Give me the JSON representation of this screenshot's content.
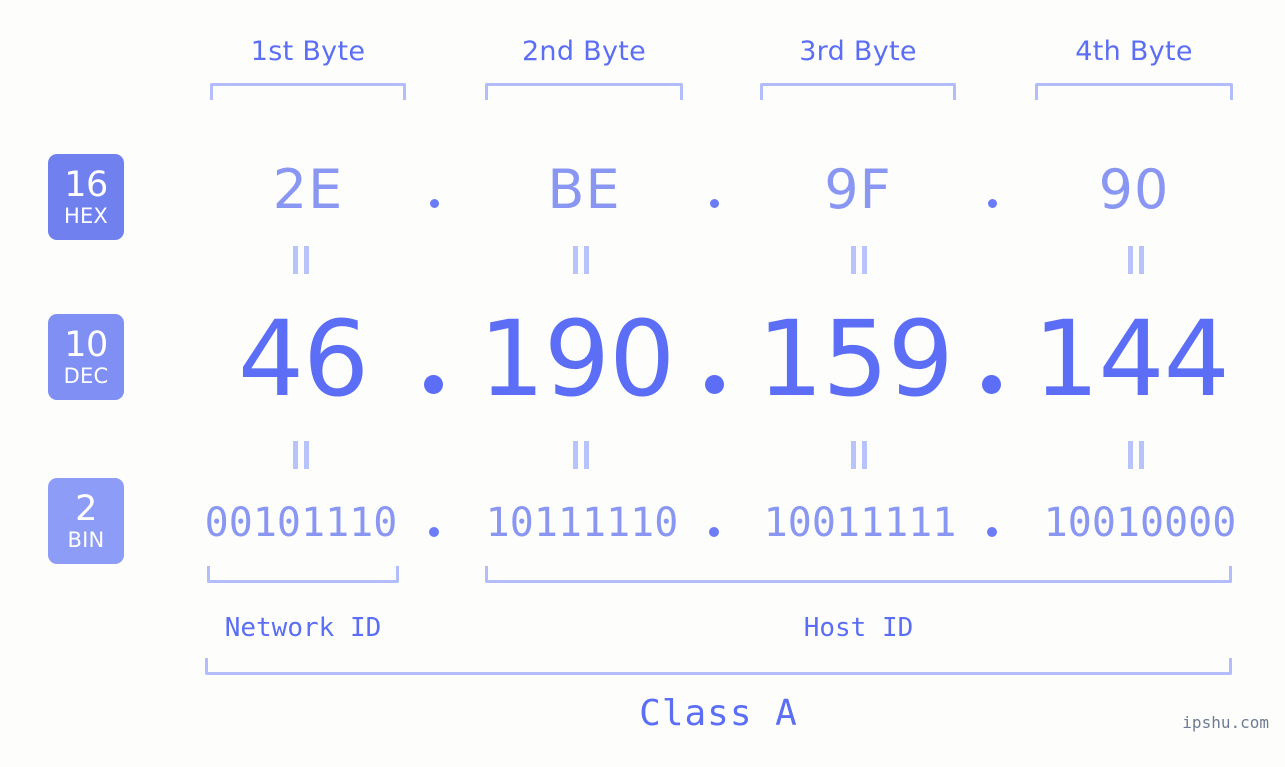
{
  "background_color": "#fdfefb",
  "accent_color": "#5b6ef5",
  "accent_light_color": "#8a97f2",
  "bracket_color": "#b3bdfb",
  "byte_headers": [
    {
      "label": "1st Byte"
    },
    {
      "label": "2nd Byte"
    },
    {
      "label": "3rd Byte"
    },
    {
      "label": "4th Byte"
    }
  ],
  "rows": {
    "hex": {
      "badge_number": "16",
      "badge_abbr": "HEX",
      "badge_color": "#7081ef",
      "values": [
        "2E",
        "BE",
        "9F",
        "90"
      ],
      "separator": "."
    },
    "dec": {
      "badge_number": "10",
      "badge_abbr": "DEC",
      "badge_color": "#7f8ff3",
      "values": [
        "46",
        "190",
        "159",
        "144"
      ],
      "separator": "."
    },
    "bin": {
      "badge_number": "2",
      "badge_abbr": "BIN",
      "badge_color": "#8d9cf6",
      "values": [
        "00101110",
        "10111110",
        "10011111",
        "10010000"
      ],
      "separator": "."
    }
  },
  "equals_symbol": "=",
  "footer": {
    "network_id_label": "Network ID",
    "host_id_label": "Host ID",
    "class_label": "Class A"
  },
  "watermark": "ipshu.com"
}
